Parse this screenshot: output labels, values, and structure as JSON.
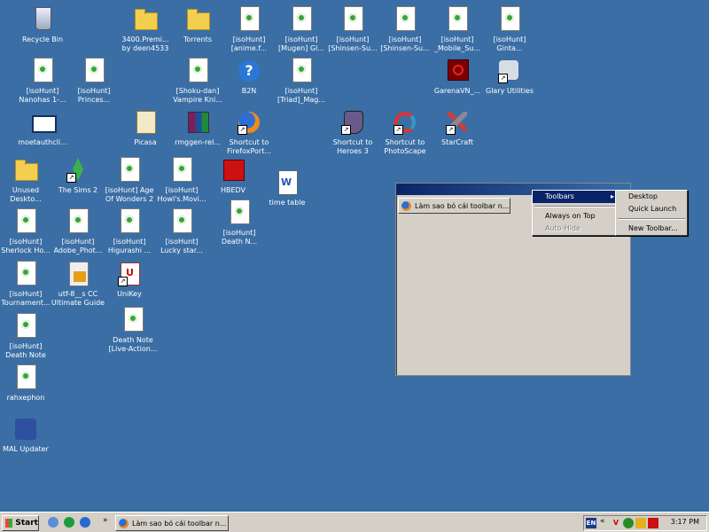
{
  "desktop_icons": [
    {
      "id": "recycle",
      "label": "Recycle Bin",
      "icon": "recycle-bin-icon",
      "type": "recycle"
    },
    {
      "id": "premi",
      "label": "3400.Premi...\nby deen4533",
      "icon": "folder-icon",
      "type": "folder"
    },
    {
      "id": "torrents",
      "label": "Torrents",
      "icon": "folder-icon",
      "type": "folder"
    },
    {
      "id": "anime",
      "label": "[isoHunt]\n[anime.f...",
      "icon": "utorrent-file-icon",
      "type": "file"
    },
    {
      "id": "mugen",
      "label": "[isoHunt]\n[Mugen] Gl...",
      "icon": "utorrent-file-icon",
      "type": "file"
    },
    {
      "id": "shinsen1",
      "label": "[isoHunt]\n[Shinsen-Su...",
      "icon": "utorrent-file-icon",
      "type": "file"
    },
    {
      "id": "shinsen2",
      "label": "[isoHunt]\n[Shinsen-Su...",
      "icon": "utorrent-file-icon",
      "type": "file"
    },
    {
      "id": "mobile",
      "label": "[isoHunt]\n_Mobile_Su...",
      "icon": "utorrent-file-icon",
      "type": "file"
    },
    {
      "id": "ginta",
      "label": "[isoHunt]\nGinta...",
      "icon": "utorrent-file-icon",
      "type": "file"
    },
    {
      "id": "nanohas",
      "label": "[isoHunt]\nNanohas 1-...",
      "icon": "utorrent-file-icon",
      "type": "file"
    },
    {
      "id": "princes",
      "label": "[isoHunt]\nPrinces...",
      "icon": "utorrent-file-icon",
      "type": "file"
    },
    {
      "id": "shoku",
      "label": "[Shoku-dan]\nVampire Kni...",
      "icon": "utorrent-file-icon",
      "type": "file"
    },
    {
      "id": "b2n",
      "label": "B2N",
      "icon": "help-icon",
      "type": "help"
    },
    {
      "id": "triad",
      "label": "[isoHunt]\n[Triad]_Mag...",
      "icon": "utorrent-file-icon",
      "type": "file"
    },
    {
      "id": "garena",
      "label": "GarenaVN_...",
      "icon": "garena-icon",
      "type": "red"
    },
    {
      "id": "glary",
      "label": "Glary Utilities",
      "icon": "glary-utilities-icon",
      "type": "glary",
      "shortcut": true
    },
    {
      "id": "moetauth",
      "label": "moetauthcli...",
      "icon": "screen-icon",
      "type": "screen"
    },
    {
      "id": "picasa",
      "label": "Picasa",
      "icon": "picasa-icon",
      "type": "picasa"
    },
    {
      "id": "rmggen",
      "label": "rmggen-rel...",
      "icon": "winrar-icon",
      "type": "winrar"
    },
    {
      "id": "firefox",
      "label": "Shortcut to\nFirefoxPort...",
      "icon": "firefox-icon",
      "type": "firefox",
      "shortcut": true
    },
    {
      "id": "heroes",
      "label": "Shortcut to\nHeroes 3",
      "icon": "heroes-icon",
      "type": "heroes",
      "shortcut": true
    },
    {
      "id": "photoscape",
      "label": "Shortcut to\nPhotoScape",
      "icon": "photoscape-icon",
      "type": "photoscape",
      "shortcut": true
    },
    {
      "id": "starcraft",
      "label": "StarCraft",
      "icon": "starcraft-icon",
      "type": "starcraft",
      "shortcut": true
    },
    {
      "id": "unused",
      "label": "Unused\nDeskto...",
      "icon": "folder-icon",
      "type": "folder"
    },
    {
      "id": "sims",
      "label": "The Sims 2",
      "icon": "sims-icon",
      "type": "sims",
      "shortcut": true
    },
    {
      "id": "age",
      "label": "[isoHunt] Age\nOf Wonders 2",
      "icon": "utorrent-file-icon",
      "type": "file"
    },
    {
      "id": "howls",
      "label": "[isoHunt]\nHowl's.Movi...",
      "icon": "utorrent-file-icon",
      "type": "file"
    },
    {
      "id": "hbedv",
      "label": "HBEDV",
      "icon": "hbedv-icon",
      "type": "hbedv"
    },
    {
      "id": "timetable",
      "label": "time table",
      "icon": "word-document-icon",
      "type": "word"
    },
    {
      "id": "sherlock",
      "label": "[isoHunt]\nSherlock Ho...",
      "icon": "utorrent-file-icon",
      "type": "file"
    },
    {
      "id": "adobe",
      "label": "[isoHunt]\nAdobe_Phot...",
      "icon": "utorrent-file-icon",
      "type": "file"
    },
    {
      "id": "higurashi",
      "label": "[isoHunt]\nHigurashi ...",
      "icon": "utorrent-file-icon",
      "type": "file"
    },
    {
      "id": "lucky",
      "label": "[isoHunt]\nLucky star...",
      "icon": "utorrent-file-icon",
      "type": "file"
    },
    {
      "id": "deathn",
      "label": "[isoHunt]\nDeath N...",
      "icon": "utorrent-file-icon",
      "type": "file"
    },
    {
      "id": "tournament",
      "label": "[isoHunt]\nTournament...",
      "icon": "utorrent-file-icon",
      "type": "file"
    },
    {
      "id": "utf8",
      "label": "utf-8__s CC\nUltimate Guide",
      "icon": "pdf-icon",
      "type": "pdf"
    },
    {
      "id": "unikey",
      "label": "UniKey",
      "icon": "unikey-icon",
      "type": "unikey",
      "shortcut": true
    },
    {
      "id": "deathnote",
      "label": "[isoHunt]\nDeath Note",
      "icon": "utorrent-file-icon",
      "type": "file"
    },
    {
      "id": "deathlive",
      "label": "Death Note\n[Live-Action...",
      "icon": "utorrent-file-icon",
      "type": "file"
    },
    {
      "id": "rahxephon",
      "label": "rahxephon",
      "icon": "utorrent-file-icon",
      "type": "file"
    },
    {
      "id": "mal",
      "label": "MAL Updater",
      "icon": "mal-updater-icon",
      "type": "mal"
    }
  ],
  "toolbar_window": {
    "button_label": "Làm sao bỏ cái toolbar n..."
  },
  "context_menu": {
    "items": [
      {
        "label": "Toolbars",
        "selected": true,
        "submenu": true
      },
      {
        "label": "Always on Top"
      },
      {
        "label": "Auto-Hide",
        "disabled": true
      }
    ]
  },
  "toolbars_submenu": {
    "items": [
      "Desktop",
      "Quick Launch",
      "New Toolbar..."
    ]
  },
  "taskbar": {
    "start_label": "Start",
    "task_label": "Làm sao bỏ cái toolbar n...",
    "chevron": "»",
    "tray_chevron": "«",
    "tray_lang": "EN",
    "clock": "3:17 PM"
  },
  "colors": {
    "desktop": "#3a6ea5",
    "title_bar": "#0a246a",
    "menu_highlight": "#0a246a",
    "face": "#d4d0c8"
  }
}
